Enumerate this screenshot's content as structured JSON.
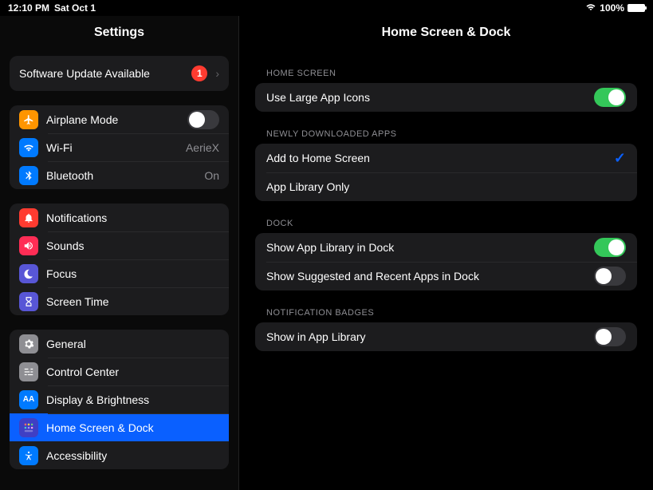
{
  "status": {
    "time": "12:10 PM",
    "date": "Sat Oct 1",
    "battery": "100%"
  },
  "sidebar": {
    "title": "Settings",
    "update": {
      "label": "Software Update Available",
      "badge": "1"
    },
    "connectivity": {
      "airplane": "Airplane Mode",
      "wifi": "Wi-Fi",
      "wifi_value": "AerieX",
      "bluetooth": "Bluetooth",
      "bluetooth_value": "On"
    },
    "attention": {
      "notifications": "Notifications",
      "sounds": "Sounds",
      "focus": "Focus",
      "screen_time": "Screen Time"
    },
    "general_group": {
      "general": "General",
      "control_center": "Control Center",
      "display": "Display & Brightness",
      "home_dock": "Home Screen & Dock",
      "accessibility": "Accessibility"
    }
  },
  "detail": {
    "title": "Home Screen & Dock",
    "sections": {
      "home_screen": {
        "header": "HOME SCREEN",
        "large_icons": "Use Large App Icons"
      },
      "newly_downloaded": {
        "header": "NEWLY DOWNLOADED APPS",
        "add_home": "Add to Home Screen",
        "app_library_only": "App Library Only"
      },
      "dock": {
        "header": "DOCK",
        "show_app_library": "Show App Library in Dock",
        "show_suggested": "Show Suggested and Recent Apps in Dock"
      },
      "notification_badges": {
        "header": "NOTIFICATION BADGES",
        "show_in_library": "Show in App Library"
      }
    }
  }
}
